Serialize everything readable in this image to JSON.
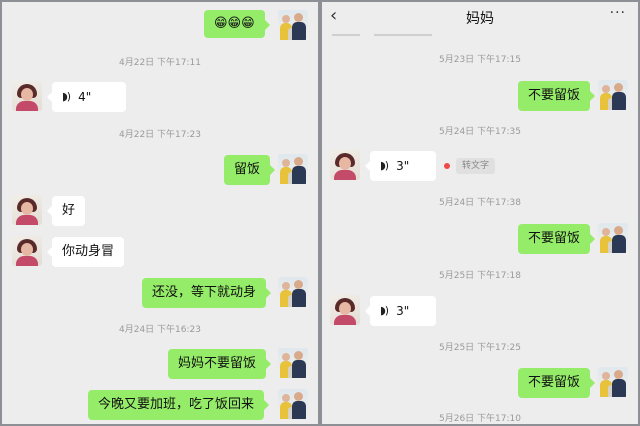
{
  "left": {
    "top_message": "😁😁😁",
    "messages": [
      {
        "time": "4月22日 下午17:11"
      },
      {
        "voice_length": "4\""
      },
      {
        "time": "4月22日 下午17:23"
      },
      {
        "text": "留饭"
      },
      {
        "text": "好"
      },
      {
        "text": "你动身冒"
      },
      {
        "text": "还没，等下就动身"
      },
      {
        "time": "4月24日 下午16:23"
      },
      {
        "text": "妈妈不要留饭"
      },
      {
        "text": "今晚又要加班，吃了饭回来"
      }
    ]
  },
  "right": {
    "header": {
      "title": "妈妈",
      "back_icon": "chevron-left-icon",
      "more_icon": "more-icon"
    },
    "messages": [
      {
        "time": "5月23日 下午17:15"
      },
      {
        "text": "不要留饭"
      },
      {
        "time": "5月24日 下午17:35"
      },
      {
        "voice_length": "3\"",
        "transcribe_label": "转文字"
      },
      {
        "time": "5月24日 下午17:38"
      },
      {
        "text": "不要留饭"
      },
      {
        "time": "5月25日 下午17:18"
      },
      {
        "voice_length": "3\""
      },
      {
        "time": "5月25日 下午17:25"
      },
      {
        "text": "不要留饭"
      },
      {
        "time": "5月26日 下午17:10"
      }
    ]
  },
  "colors": {
    "outgoing_bubble": "#95ec69",
    "incoming_bubble": "#ffffff",
    "background": "#ededed",
    "unread_dot": "#f04747"
  }
}
